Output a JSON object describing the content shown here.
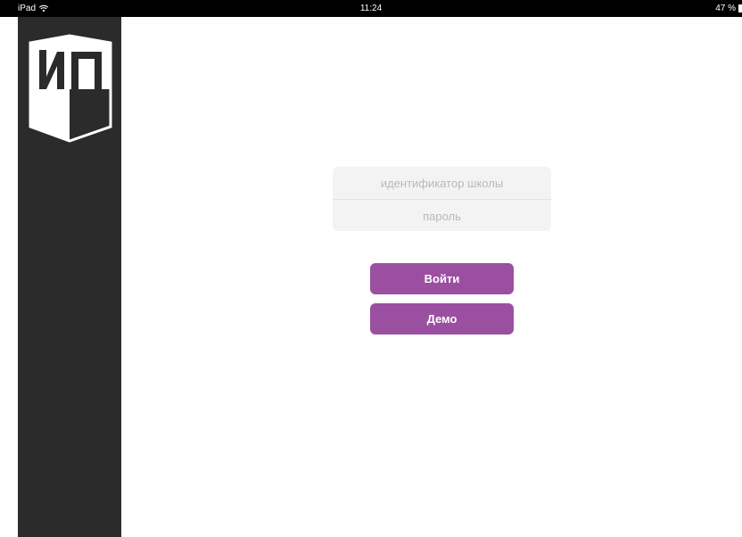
{
  "status_bar": {
    "device": "iPad",
    "time": "11:24",
    "battery": "47 %",
    "icons": [
      "wifi-icon",
      "battery-icon"
    ]
  },
  "sidebar": {
    "logo": "ИП",
    "background": "#2b2b2b"
  },
  "login": {
    "school_id_placeholder": "идентификатор школы",
    "password_placeholder": "пароль",
    "login_label": "Войти",
    "demo_label": "Демо"
  },
  "colors": {
    "accent": "#9b4fa0",
    "field_bg": "#f3f3f3"
  }
}
